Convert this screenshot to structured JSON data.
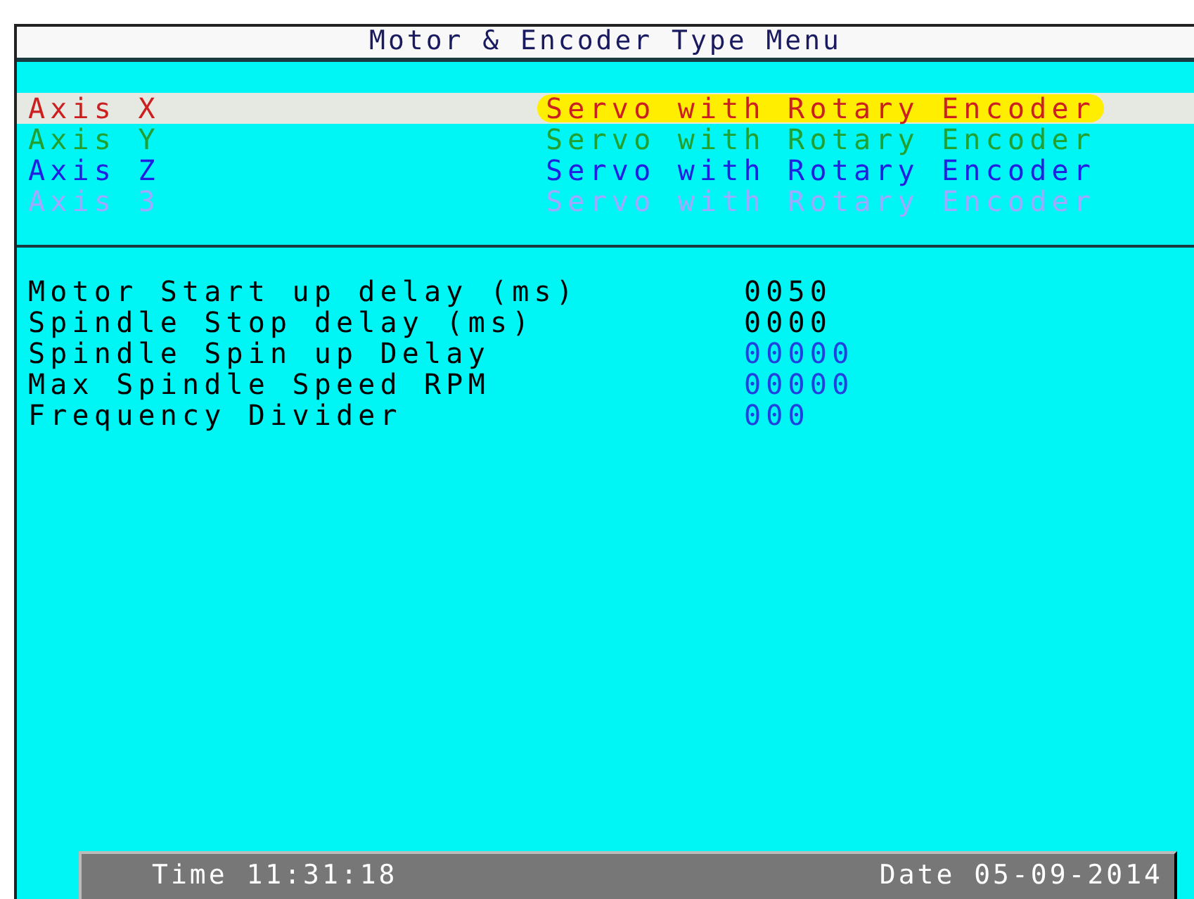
{
  "window": {
    "title": "Motor & Encoder Type Menu"
  },
  "axes": [
    {
      "name": "Axis X",
      "type": "Servo with Rotary Encoder",
      "selected": true,
      "color": "#cc2020"
    },
    {
      "name": "Axis Y",
      "type": "Servo with Rotary Encoder",
      "selected": false,
      "color": "#20a030"
    },
    {
      "name": "Axis Z",
      "type": "Servo with Rotary Encoder",
      "selected": false,
      "color": "#2020e0"
    },
    {
      "name": "Axis 3",
      "type": "Servo with Rotary Encoder",
      "selected": false,
      "color": "#a0a8ff"
    }
  ],
  "parameters": [
    {
      "label": "Motor Start up delay (ms)",
      "value": "0050",
      "color": "#000000"
    },
    {
      "label": "Spindle Stop delay (ms)",
      "value": "0000",
      "color": "#000000"
    },
    {
      "label": "Spindle Spin up Delay",
      "value": "00000",
      "color": "#2040e0"
    },
    {
      "label": "Max Spindle Speed RPM",
      "value": "00000",
      "color": "#2040e0"
    },
    {
      "label": "Frequency Divider",
      "value": "000",
      "color": "#2040e0"
    }
  ],
  "status_bar": {
    "time": "Time 11:31:18",
    "date": "Date 05-09-2014"
  }
}
